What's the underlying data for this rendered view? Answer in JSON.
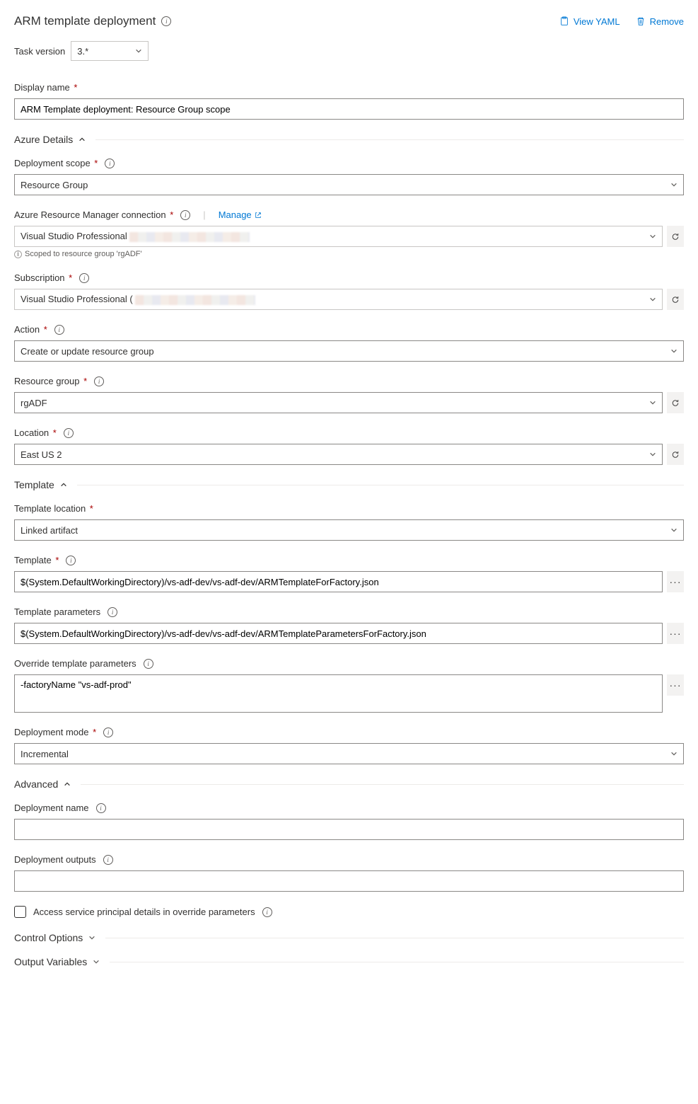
{
  "header": {
    "title": "ARM template deployment",
    "view_yaml": "View YAML",
    "remove": "Remove"
  },
  "task_version": {
    "label": "Task version",
    "value": "3.*"
  },
  "display_name": {
    "label": "Display name",
    "value": "ARM Template deployment: Resource Group scope"
  },
  "sections": {
    "azure_details": "Azure Details",
    "template": "Template",
    "advanced": "Advanced",
    "control_options": "Control Options",
    "output_variables": "Output Variables"
  },
  "azure": {
    "deployment_scope": {
      "label": "Deployment scope",
      "value": "Resource Group"
    },
    "arm_connection": {
      "label": "Azure Resource Manager connection",
      "manage": "Manage",
      "value": "Visual Studio Professional",
      "helper": "Scoped to resource group 'rgADF'"
    },
    "subscription": {
      "label": "Subscription",
      "value": "Visual Studio Professional ("
    },
    "action": {
      "label": "Action",
      "value": "Create or update resource group"
    },
    "resource_group": {
      "label": "Resource group",
      "value": "rgADF"
    },
    "location": {
      "label": "Location",
      "value": "East US 2"
    }
  },
  "template": {
    "location": {
      "label": "Template location",
      "value": "Linked artifact"
    },
    "template": {
      "label": "Template",
      "value": "$(System.DefaultWorkingDirectory)/vs-adf-dev/vs-adf-dev/ARMTemplateForFactory.json"
    },
    "parameters": {
      "label": "Template parameters",
      "value": "$(System.DefaultWorkingDirectory)/vs-adf-dev/vs-adf-dev/ARMTemplateParametersForFactory.json"
    },
    "override": {
      "label": "Override template parameters",
      "value": "-factoryName \"vs-adf-prod\""
    },
    "deployment_mode": {
      "label": "Deployment mode",
      "value": "Incremental"
    }
  },
  "advanced": {
    "deployment_name": {
      "label": "Deployment name",
      "value": ""
    },
    "deployment_outputs": {
      "label": "Deployment outputs",
      "value": ""
    },
    "access_sp": {
      "label": "Access service principal details in override parameters"
    }
  }
}
